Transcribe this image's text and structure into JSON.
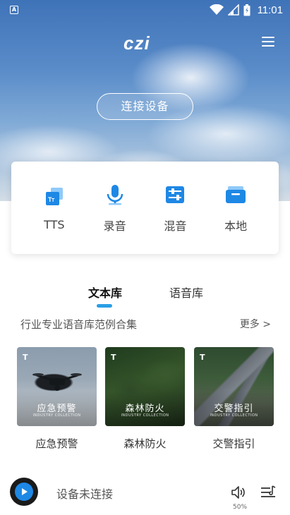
{
  "status_bar": {
    "time": "11:01",
    "app_icon": "A"
  },
  "header": {
    "logo": "czi",
    "menu_icon": "hamburger-menu-icon"
  },
  "connect_button": {
    "label": "连接设备"
  },
  "functions": [
    {
      "label": "TTS",
      "icon": "tts-icon"
    },
    {
      "label": "录音",
      "icon": "microphone-icon"
    },
    {
      "label": "混音",
      "icon": "mixer-icon"
    },
    {
      "label": "本地",
      "icon": "local-folder-icon"
    }
  ],
  "tabs": [
    {
      "label": "文本库",
      "active": true
    },
    {
      "label": "语音库",
      "active": false
    }
  ],
  "section": {
    "title": "行业专业语音库范例合集",
    "more": "更多 >"
  },
  "cards": [
    {
      "title": "应急预警",
      "overlay_title": "应急预警",
      "overlay_sub": "INDUSTRY COLLECTION",
      "tag": "T"
    },
    {
      "title": "森林防火",
      "overlay_title": "森林防火",
      "overlay_sub": "INDUSTRY COLLECTION",
      "tag": "T"
    },
    {
      "title": "交警指引",
      "overlay_title": "交警指引",
      "overlay_sub": "INDUSTRY COLLECTION",
      "tag": "T"
    }
  ],
  "player": {
    "status": "设备未连接",
    "volume": "50%"
  },
  "colors": {
    "accent": "#2a9fe6",
    "icon_blue": "#1e88e5"
  }
}
